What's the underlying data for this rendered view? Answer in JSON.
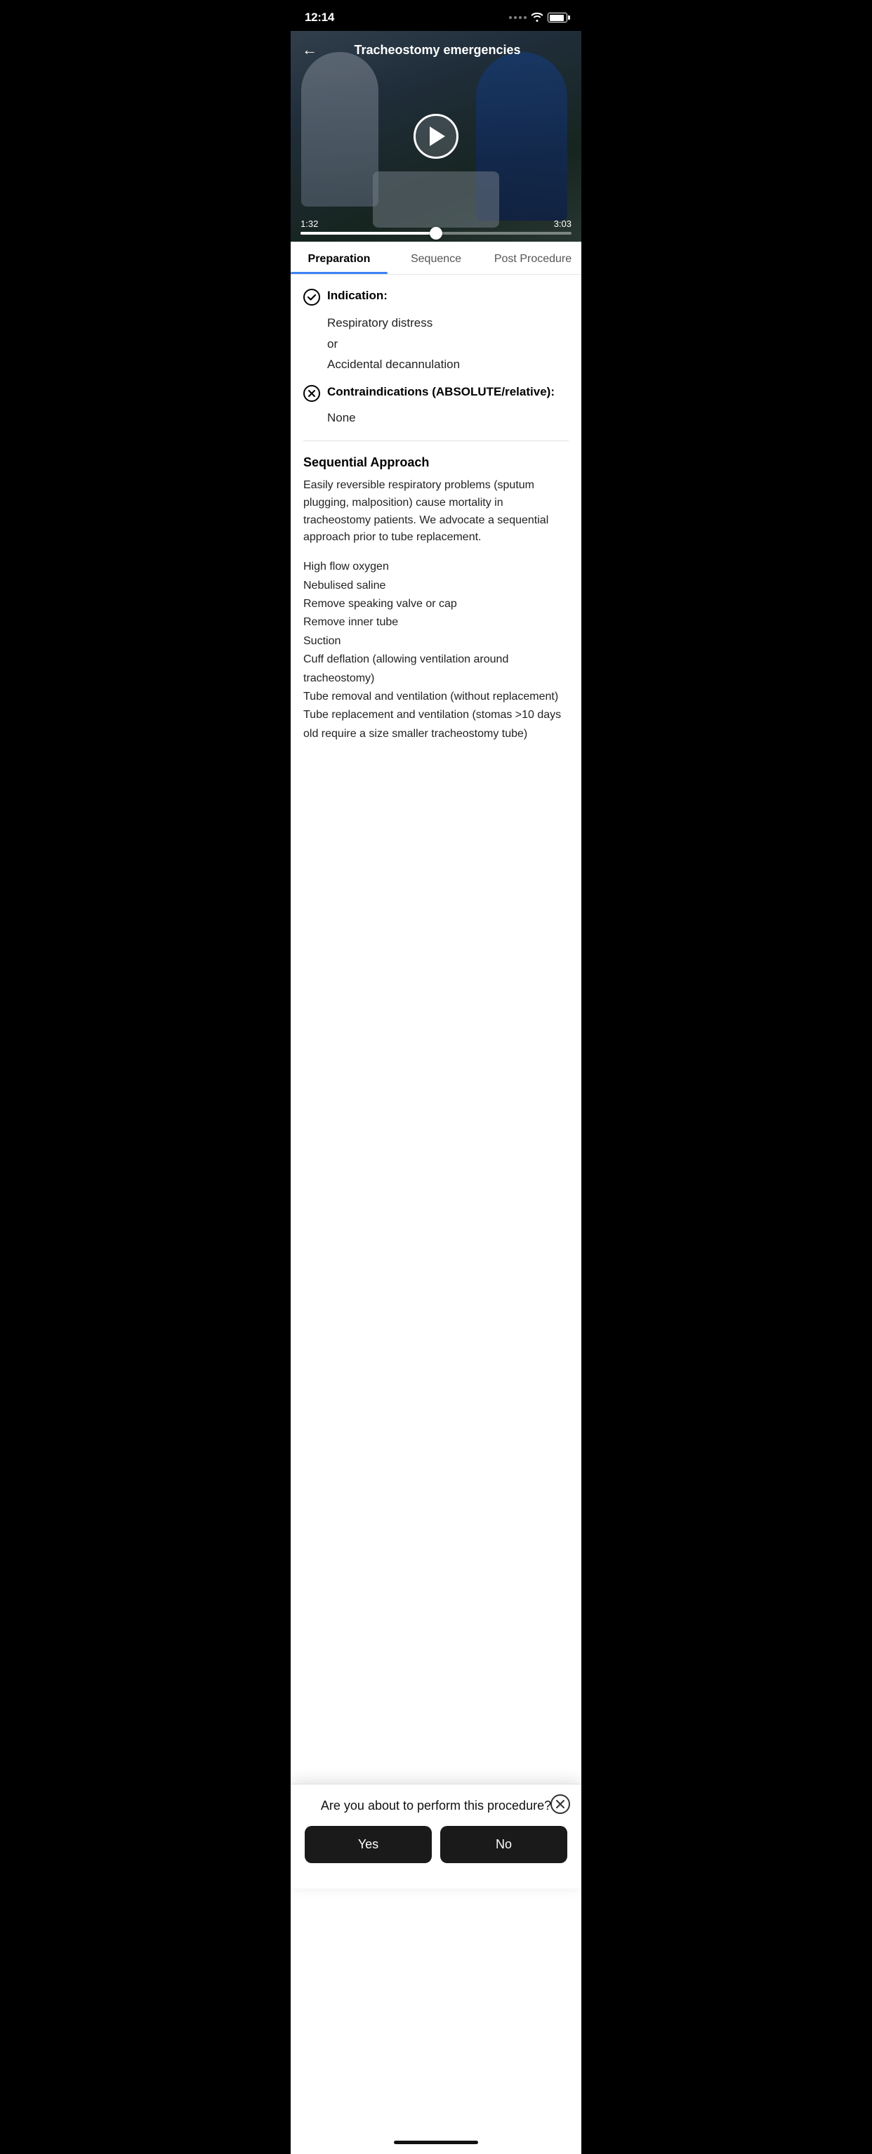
{
  "statusBar": {
    "time": "12:14"
  },
  "video": {
    "title": "Tracheostomy emergencies",
    "currentTime": "1:32",
    "totalTime": "3:03",
    "progress": 50
  },
  "tabs": [
    {
      "id": "preparation",
      "label": "Preparation",
      "active": true
    },
    {
      "id": "sequence",
      "label": "Sequence",
      "active": false
    },
    {
      "id": "post-procedure",
      "label": "Post Procedure",
      "active": false
    }
  ],
  "preparation": {
    "indication": {
      "title": "Indication:",
      "details": [
        "Respiratory distress",
        "or",
        "Accidental decannulation"
      ]
    },
    "contraindications": {
      "title": "Contraindications (ABSOLUTE/relative):",
      "details": "None"
    },
    "sequentialApproach": {
      "title": "Sequential Approach",
      "body": "Easily reversible respiratory problems (sputum plugging, malposition) cause mortality in tracheostomy patients. We advocate a sequential approach prior to tube replacement.",
      "steps": [
        "High flow oxygen",
        "Nebulised saline",
        "Remove speaking valve or cap",
        "Remove inner tube",
        "Suction",
        "Cuff deflation (allowing ventilation around tracheostomy)",
        "Tube removal and ventilation (without replacement)",
        "Tube replacement and ventilation (stomas >10 days old require a size smaller tracheostomy tube)"
      ]
    }
  },
  "modal": {
    "question": "Are you about to perform this procedure?",
    "yesLabel": "Yes",
    "noLabel": "No"
  },
  "icons": {
    "back": "←",
    "play": "▶",
    "check": "✓",
    "xCircle": "✕",
    "close": "✕"
  }
}
